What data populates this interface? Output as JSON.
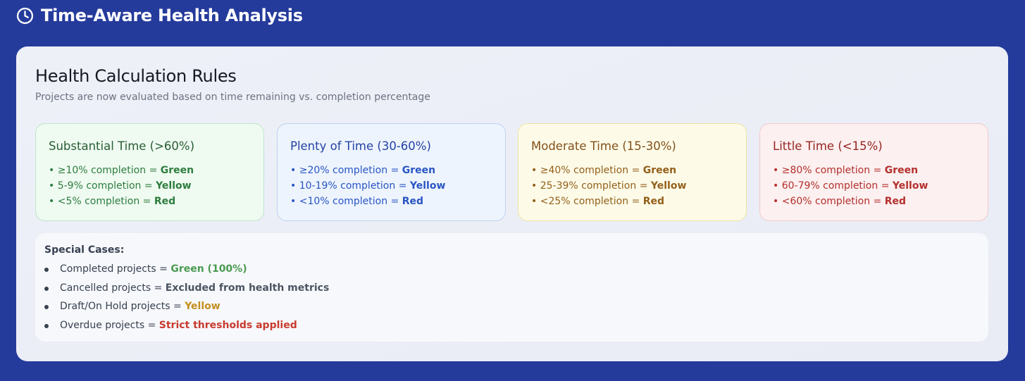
{
  "header": {
    "icon": "clock-icon",
    "title": "Time-Aware Health Analysis"
  },
  "panel": {
    "title": "Health Calculation Rules",
    "subtitle": "Projects are now evaluated based on time remaining vs. completion percentage"
  },
  "cards": [
    {
      "title": "Substantial Time (>60%)",
      "rules": [
        {
          "text": "• ≥10% completion = ",
          "status": "Green"
        },
        {
          "text": "• 5-9% completion = ",
          "status": "Yellow"
        },
        {
          "text": "• <5% completion = ",
          "status": "Red"
        }
      ]
    },
    {
      "title": "Plenty of Time (30-60%)",
      "rules": [
        {
          "text": "• ≥20% completion = ",
          "status": "Green"
        },
        {
          "text": "• 10-19% completion = ",
          "status": "Yellow"
        },
        {
          "text": "• <10% completion = ",
          "status": "Red"
        }
      ]
    },
    {
      "title": "Moderate Time (15-30%)",
      "rules": [
        {
          "text": "• ≥40% completion = ",
          "status": "Green"
        },
        {
          "text": "• 25-39% completion = ",
          "status": "Yellow"
        },
        {
          "text": "• <25% completion = ",
          "status": "Red"
        }
      ]
    },
    {
      "title": "Little Time (<15%)",
      "rules": [
        {
          "text": "• ≥80% completion = ",
          "status": "Green"
        },
        {
          "text": "• 60-79% completion = ",
          "status": "Yellow"
        },
        {
          "text": "• <60% completion = ",
          "status": "Red"
        }
      ]
    }
  ],
  "special": {
    "title": "Special Cases:",
    "items": [
      {
        "text": "Completed projects = ",
        "value": "Green (100%)"
      },
      {
        "text": "Cancelled projects = ",
        "value": "Excluded from health metrics"
      },
      {
        "text": "Draft/On Hold projects = ",
        "value": "Yellow"
      },
      {
        "text": "Overdue projects = ",
        "value": "Strict thresholds applied"
      }
    ]
  },
  "colors": {
    "background": "#253b9c",
    "green": "#4a9a52",
    "yellow": "#c38f1f",
    "red": "#c73a2e"
  }
}
